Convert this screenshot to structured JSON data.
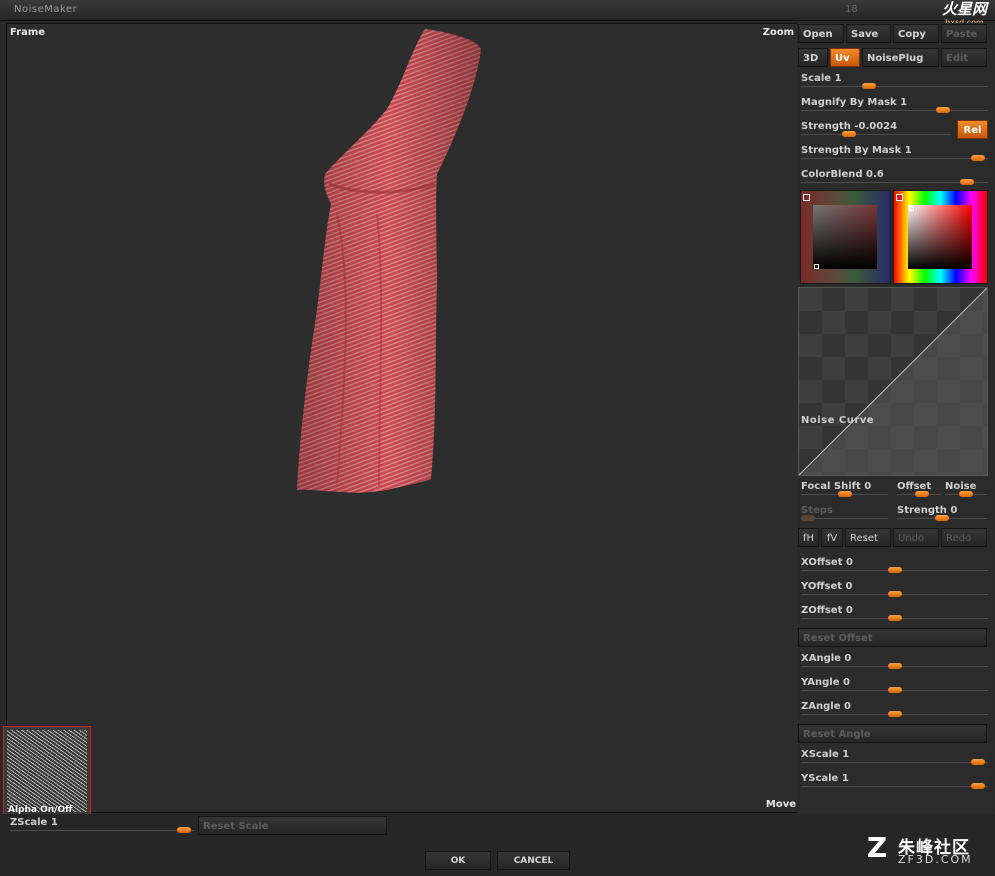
{
  "window": {
    "title": "NoiseMaker",
    "title_number": "18"
  },
  "site_logo": {
    "main": "火星网",
    "sub": "hxsd.com"
  },
  "viewport": {
    "frame_label": "Frame",
    "zoom_label": "Zoom",
    "move_label": "Move",
    "alpha_label": "Alpha On/Off"
  },
  "toolbar": {
    "open": "Open",
    "save": "Save",
    "copy": "Copy",
    "paste": "Paste",
    "mode_3d": "3D",
    "mode_uv": "Uv",
    "noiseplug": "NoisePlug",
    "edit": "Edit"
  },
  "sliders": {
    "scale": {
      "label": "Scale",
      "value": "1",
      "level": 0.35
    },
    "magnify_by_mask": {
      "label": "Magnify By Mask",
      "value": "1",
      "level": 0.78
    },
    "strength": {
      "label": "Strength",
      "value": "-0.0024",
      "level": 0.3
    },
    "strength_by_mask": {
      "label": "Strength By Mask",
      "value": "1",
      "level": 0.98
    },
    "colorblend": {
      "label": "ColorBlend",
      "value": "0.6",
      "level": 0.92
    },
    "focal_shift": {
      "label": "Focal Shift",
      "value": "0",
      "level": 0.5
    },
    "offset": {
      "label": "Offset",
      "level": 0.6
    },
    "noise": {
      "label": "Noise",
      "level": 0.5
    },
    "steps": {
      "label": "Steps",
      "level": 0.0
    },
    "curve_strength": {
      "label": "Strength",
      "value": "0",
      "level": 0.5
    },
    "xoffset": {
      "label": "XOffset",
      "value": "0",
      "level": 0.5
    },
    "yoffset": {
      "label": "YOffset",
      "value": "0",
      "level": 0.5
    },
    "zoffset": {
      "label": "ZOffset",
      "value": "0",
      "level": 0.5
    },
    "xangle": {
      "label": "XAngle",
      "value": "0",
      "level": 0.5
    },
    "yangle": {
      "label": "YAngle",
      "value": "0",
      "level": 0.5
    },
    "zangle": {
      "label": "ZAngle",
      "value": "0",
      "level": 0.5
    },
    "xscale": {
      "label": "XScale",
      "value": "1",
      "level": 0.98
    },
    "yscale": {
      "label": "YScale",
      "value": "1",
      "level": 0.98
    },
    "zscale": {
      "label": "ZScale",
      "value": "1",
      "level": 0.98
    }
  },
  "buttons": {
    "rel": "Rel",
    "fh": "fH",
    "fv": "fV",
    "reset": "Reset",
    "undo": "Undo",
    "redo": "Redo",
    "reset_offset": "Reset Offset",
    "reset_angle": "Reset Angle",
    "reset_scale": "Reset Scale",
    "ok": "OK",
    "cancel": "CANCEL"
  },
  "curve": {
    "label": "Noise Curve"
  },
  "watermark": {
    "logo": "Z",
    "name": "朱峰社区",
    "url": "ZF3D.COM"
  },
  "colors": {
    "accent": "#e8781a",
    "background": "#2a2a2a",
    "mesh": "#c84a50"
  }
}
